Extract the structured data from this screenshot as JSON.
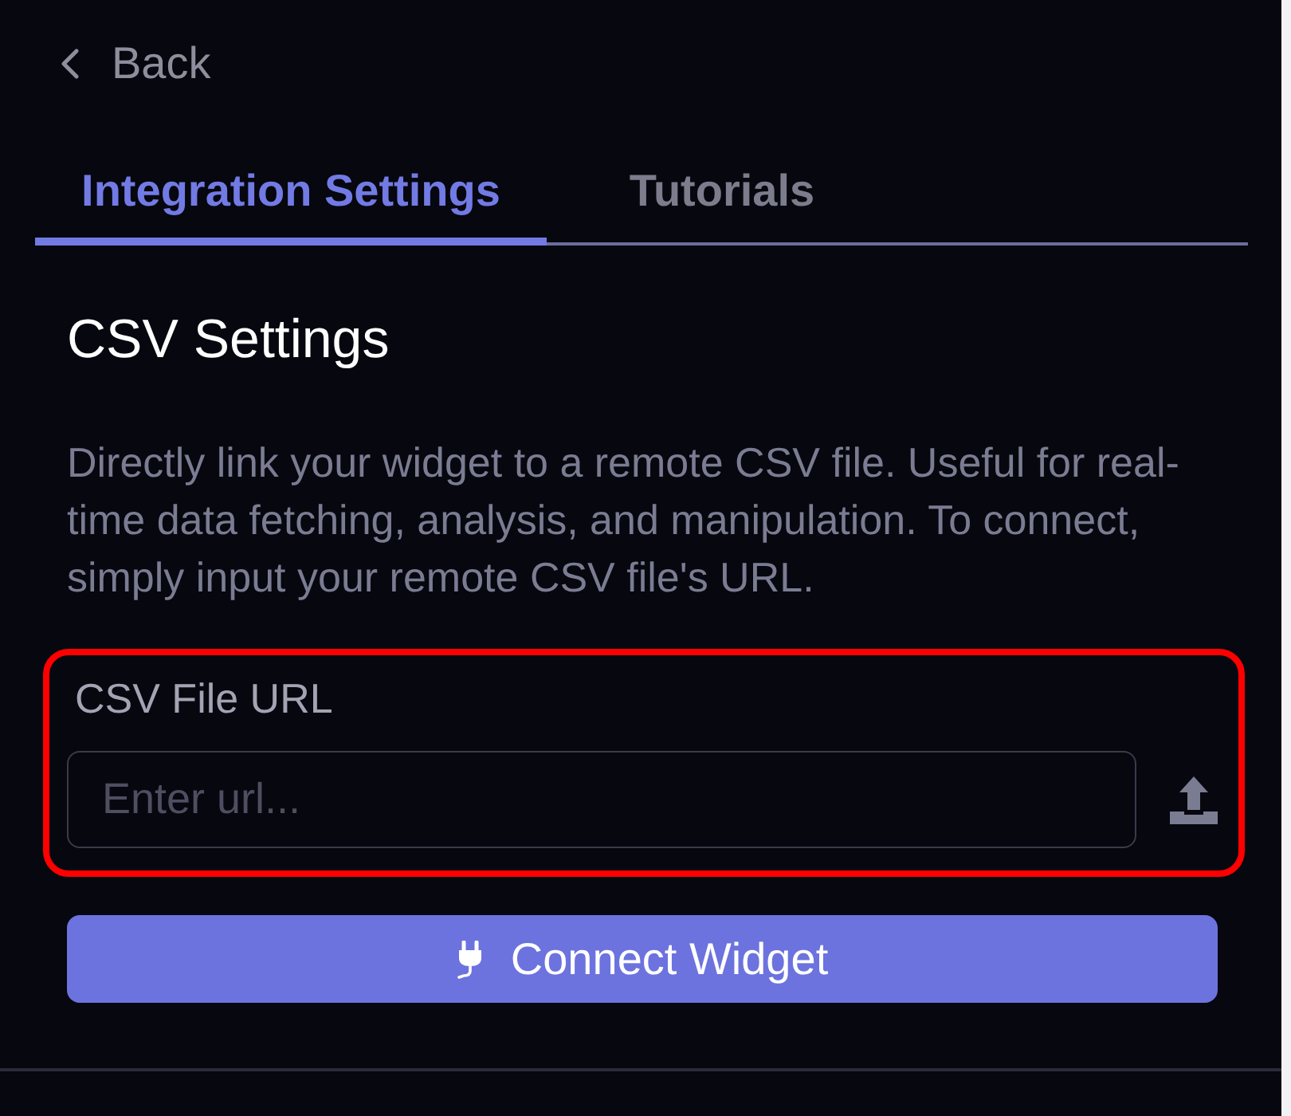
{
  "back": {
    "label": "Back"
  },
  "tabs": [
    {
      "label": "Integration Settings",
      "selected": true
    },
    {
      "label": "Tutorials",
      "selected": false
    }
  ],
  "section": {
    "title": "CSV Settings",
    "description": "Directly link your widget to a remote CSV file. Useful for real-time data fetching, analysis, and manipulation. To connect, simply input your remote CSV file's URL."
  },
  "url_field": {
    "label": "CSV File URL",
    "placeholder": "Enter url...",
    "highlighted": true
  },
  "connect_button": {
    "label": "Connect Widget"
  }
}
